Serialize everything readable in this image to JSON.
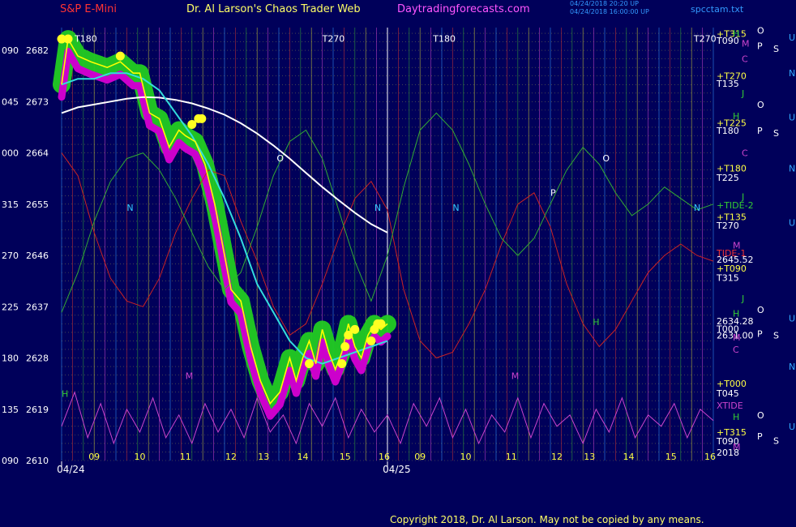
{
  "header": {
    "left": "S&P E-Mini",
    "center": "Dr. Al Larson's Chaos Trader Web",
    "site": "Daytradingforecasts.com",
    "right": "spcctam.txt",
    "stamp1": "04/24/2018 20:20 UP",
    "stamp2": "04/24/2018 16:00:00 UP"
  },
  "colors": {
    "background": "#00005a",
    "price_line": "#ffff00",
    "price_glow": "#22cc22",
    "magenta_band": "#cc00cc",
    "cyan_avg": "#33dddd",
    "white_avg": "#ffffff",
    "tide1": "#cc2222",
    "tide2": "#33aa33",
    "xtide": "#cc44cc"
  },
  "chart_data": {
    "type": "line",
    "title": "S&P E-Mini",
    "ylim": [
      2610,
      2686
    ],
    "xlim": [
      0,
      2
    ],
    "y_ticks": [
      {
        "angle": "090",
        "price": 2682
      },
      {
        "angle": "045",
        "price": 2673
      },
      {
        "angle": "000",
        "price": 2664
      },
      {
        "angle": "315",
        "price": 2655
      },
      {
        "angle": "270",
        "price": 2646
      },
      {
        "angle": "225",
        "price": 2637
      },
      {
        "angle": "180",
        "price": 2628
      },
      {
        "angle": "135",
        "price": 2619
      },
      {
        "angle": "090",
        "price": 2610
      }
    ],
    "x_ticks": [
      {
        "label": "09",
        "x": 0.1
      },
      {
        "label": "10",
        "x": 0.24
      },
      {
        "label": "11",
        "x": 0.38
      },
      {
        "label": "12",
        "x": 0.52
      },
      {
        "label": "13",
        "x": 0.62
      },
      {
        "label": "14",
        "x": 0.74
      },
      {
        "label": "15",
        "x": 0.87
      },
      {
        "label": "16",
        "x": 0.99
      },
      {
        "label": "09",
        "x": 1.1
      },
      {
        "label": "10",
        "x": 1.24
      },
      {
        "label": "11",
        "x": 1.38
      },
      {
        "label": "12",
        "x": 1.52
      },
      {
        "label": "13",
        "x": 1.62
      },
      {
        "label": "14",
        "x": 1.74
      },
      {
        "label": "15",
        "x": 1.87
      },
      {
        "label": "16",
        "x": 1.99
      }
    ],
    "dates": [
      {
        "label": "04/24",
        "x": 0.05
      },
      {
        "label": "04/25",
        "x": 1.05
      }
    ],
    "price": {
      "x": [
        0.0,
        0.02,
        0.05,
        0.09,
        0.14,
        0.18,
        0.22,
        0.24,
        0.27,
        0.3,
        0.33,
        0.36,
        0.38,
        0.41,
        0.44,
        0.47,
        0.49,
        0.52,
        0.55,
        0.58,
        0.61,
        0.64,
        0.67,
        0.7,
        0.72,
        0.74,
        0.76,
        0.78,
        0.8,
        0.82,
        0.84,
        0.86,
        0.88,
        0.9,
        0.92,
        0.94,
        0.96,
        0.98,
        1.0
      ],
      "values": [
        2676,
        2684,
        2681,
        2680,
        2679,
        2680,
        2678,
        2678,
        2671,
        2670,
        2665,
        2668,
        2667,
        2666,
        2662,
        2655,
        2649,
        2640,
        2638,
        2630,
        2624,
        2620,
        2622,
        2628,
        2624,
        2628,
        2631,
        2627,
        2633,
        2629,
        2626,
        2629,
        2634,
        2630,
        2628,
        2632,
        2634,
        2633,
        2634
      ]
    },
    "cyan_avg": {
      "x": [
        0.0,
        0.05,
        0.1,
        0.15,
        0.2,
        0.25,
        0.3,
        0.35,
        0.4,
        0.45,
        0.5,
        0.55,
        0.6,
        0.65,
        0.7,
        0.75,
        0.8,
        0.85,
        0.9,
        0.95,
        1.0
      ],
      "values": [
        2676,
        2677,
        2677,
        2678,
        2678,
        2677,
        2675,
        2671,
        2667,
        2662,
        2656,
        2649,
        2641,
        2636,
        2631,
        2628,
        2627,
        2628,
        2629,
        2630,
        2631
      ]
    },
    "white_avg": {
      "x": [
        0.0,
        0.05,
        0.1,
        0.15,
        0.2,
        0.25,
        0.3,
        0.35,
        0.4,
        0.45,
        0.5,
        0.55,
        0.6,
        0.65,
        0.7,
        0.75,
        0.8,
        0.85,
        0.9,
        0.95,
        1.0
      ],
      "values": [
        2671,
        2672,
        2672.5,
        2673,
        2673.5,
        2673.8,
        2673.7,
        2673.3,
        2672.7,
        2671.8,
        2670.7,
        2669.2,
        2667.4,
        2665.3,
        2663,
        2660.5,
        2658,
        2655.7,
        2653.5,
        2651.5,
        2650
      ]
    },
    "tide1": {
      "x": [
        0.0,
        0.05,
        0.1,
        0.15,
        0.2,
        0.25,
        0.3,
        0.35,
        0.4,
        0.45,
        0.5,
        0.55,
        0.6,
        0.65,
        0.7,
        0.75,
        0.8,
        0.85,
        0.9,
        0.95,
        1.0,
        1.05,
        1.1,
        1.15,
        1.2,
        1.25,
        1.3,
        1.35,
        1.4,
        1.45,
        1.5,
        1.55,
        1.6,
        1.65,
        1.7,
        1.75,
        1.8,
        1.85,
        1.9,
        1.95,
        2.0
      ],
      "values": [
        2664,
        2660,
        2650,
        2642,
        2638,
        2637,
        2642,
        2650,
        2656,
        2661,
        2660,
        2652,
        2645,
        2637,
        2632,
        2634,
        2641,
        2649,
        2656,
        2659,
        2654,
        2640,
        2631,
        2628,
        2629,
        2634,
        2640,
        2648,
        2655,
        2657,
        2651,
        2641,
        2634,
        2630,
        2633,
        2638,
        2643,
        2646,
        2648,
        2646,
        2645
      ]
    },
    "tide2": {
      "x": [
        0.0,
        0.05,
        0.1,
        0.15,
        0.2,
        0.25,
        0.3,
        0.35,
        0.4,
        0.45,
        0.5,
        0.55,
        0.6,
        0.65,
        0.7,
        0.75,
        0.8,
        0.85,
        0.9,
        0.95,
        1.0,
        1.05,
        1.1,
        1.15,
        1.2,
        1.25,
        1.3,
        1.35,
        1.4,
        1.45,
        1.5,
        1.55,
        1.6,
        1.65,
        1.7,
        1.75,
        1.8,
        1.85,
        1.9,
        1.95,
        2.0
      ],
      "values": [
        2636,
        2643,
        2652,
        2659,
        2663,
        2664,
        2661,
        2656,
        2650,
        2644,
        2640,
        2643,
        2651,
        2660,
        2666,
        2668,
        2663,
        2654,
        2645,
        2638,
        2646,
        2658,
        2668,
        2671,
        2668,
        2662,
        2655,
        2649,
        2646,
        2649,
        2655,
        2661,
        2665,
        2662,
        2657,
        2653,
        2655,
        2658,
        2656,
        2654,
        2655
      ]
    },
    "xtide": {
      "x": [
        0.0,
        0.04,
        0.08,
        0.12,
        0.16,
        0.2,
        0.24,
        0.28,
        0.32,
        0.36,
        0.4,
        0.44,
        0.48,
        0.52,
        0.56,
        0.6,
        0.64,
        0.68,
        0.72,
        0.76,
        0.8,
        0.84,
        0.88,
        0.92,
        0.96,
        1.0,
        1.04,
        1.08,
        1.12,
        1.16,
        1.2,
        1.24,
        1.28,
        1.32,
        1.36,
        1.4,
        1.44,
        1.48,
        1.52,
        1.56,
        1.6,
        1.64,
        1.68,
        1.72,
        1.76,
        1.8,
        1.84,
        1.88,
        1.92,
        1.96,
        2.0
      ],
      "values": [
        2616,
        2622,
        2614,
        2620,
        2613,
        2619,
        2615,
        2621,
        2614,
        2618,
        2613,
        2620,
        2615,
        2619,
        2614,
        2621,
        2615,
        2618,
        2613,
        2620,
        2616,
        2621,
        2614,
        2619,
        2615,
        2618,
        2613,
        2620,
        2616,
        2621,
        2614,
        2619,
        2613,
        2618,
        2615,
        2621,
        2614,
        2620,
        2616,
        2618,
        2613,
        2619,
        2615,
        2621,
        2614,
        2618,
        2616,
        2620,
        2614,
        2619,
        2617
      ]
    },
    "yellow_dots": [
      {
        "x": 0.0,
        "y": 2684
      },
      {
        "x": 0.02,
        "y": 2684
      },
      {
        "x": 0.18,
        "y": 2681
      },
      {
        "x": 0.4,
        "y": 2669
      },
      {
        "x": 0.42,
        "y": 2670
      },
      {
        "x": 0.43,
        "y": 2670
      },
      {
        "x": 0.76,
        "y": 2627
      },
      {
        "x": 0.86,
        "y": 2627
      },
      {
        "x": 0.87,
        "y": 2630
      },
      {
        "x": 0.88,
        "y": 2632
      },
      {
        "x": 0.9,
        "y": 2633
      },
      {
        "x": 0.95,
        "y": 2631
      },
      {
        "x": 0.96,
        "y": 2633
      },
      {
        "x": 0.97,
        "y": 2634
      },
      {
        "x": 0.98,
        "y": 2634
      }
    ],
    "annotations": [
      {
        "text": "T180",
        "x": 0.04,
        "y": 2683.5,
        "color": "#ffffff"
      },
      {
        "text": "T270",
        "x": 0.8,
        "y": 2683.5,
        "color": "#ffffff"
      },
      {
        "text": "T180",
        "x": 1.14,
        "y": 2683.5,
        "color": "#ffffff"
      },
      {
        "text": "T270",
        "x": 1.94,
        "y": 2683.5,
        "color": "#ffffff"
      },
      {
        "text": "O",
        "x": 0.66,
        "y": 2662.5,
        "color": "#ffffff"
      },
      {
        "text": "O",
        "x": 1.66,
        "y": 2662.5,
        "color": "#ffffff"
      },
      {
        "text": "P",
        "x": 1.5,
        "y": 2656.5,
        "color": "#ffffff"
      },
      {
        "text": "N",
        "x": 0.2,
        "y": 2653.8,
        "color": "#33ccff"
      },
      {
        "text": "N",
        "x": 0.96,
        "y": 2653.8,
        "color": "#33ccff"
      },
      {
        "text": "N",
        "x": 1.2,
        "y": 2653.8,
        "color": "#33ccff"
      },
      {
        "text": "N",
        "x": 1.94,
        "y": 2653.8,
        "color": "#33ccff"
      },
      {
        "text": "M",
        "x": 0.38,
        "y": 2624.3,
        "color": "#cc44cc"
      },
      {
        "text": "M",
        "x": 1.38,
        "y": 2624.3,
        "color": "#cc44cc"
      },
      {
        "text": "H",
        "x": 0.0,
        "y": 2621.2,
        "color": "#33cc33"
      },
      {
        "text": "H",
        "x": 1.63,
        "y": 2633.8,
        "color": "#33cc33"
      }
    ],
    "right_labels": [
      {
        "text": "+T315",
        "price": 2684.9,
        "color": "#ffff44"
      },
      {
        "text": "T090",
        "price": 2683.7,
        "color": "#ffffff"
      },
      {
        "text": "+T270",
        "price": 2677.5,
        "color": "#ffff44"
      },
      {
        "text": "T135",
        "price": 2676.2,
        "color": "#ffffff"
      },
      {
        "text": "+T225",
        "price": 2669.3,
        "color": "#ffff44"
      },
      {
        "text": "T180",
        "price": 2667.9,
        "color": "#ffffff"
      },
      {
        "text": "+T180",
        "price": 2661.3,
        "color": "#ffff44"
      },
      {
        "text": "T225",
        "price": 2659.7,
        "color": "#ffffff"
      },
      {
        "text": "+TIDE-2",
        "price": 2654.8,
        "color": "#33cc33"
      },
      {
        "text": "+T135",
        "price": 2652.8,
        "color": "#ffff44"
      },
      {
        "text": "T270",
        "price": 2651.3,
        "color": "#ffffff"
      },
      {
        "text": "TIDE-1",
        "price": 2646.4,
        "color": "#ee3333"
      },
      {
        "text": "2645.52",
        "price": 2645.3,
        "color": "#ffffff"
      },
      {
        "text": "+T090",
        "price": 2643.7,
        "color": "#ffff44"
      },
      {
        "text": "T315",
        "price": 2642.1,
        "color": "#ffffff"
      },
      {
        "text": "2634.28",
        "price": 2634.5,
        "color": "#ffffff"
      },
      {
        "text": "T000",
        "price": 2633.1,
        "color": "#ffffff"
      },
      {
        "text": "2631.00",
        "price": 2632.0,
        "color": "#ffffff"
      },
      {
        "text": "+T000",
        "price": 2623.5,
        "color": "#ffff44"
      },
      {
        "text": "T045",
        "price": 2621.8,
        "color": "#ffffff"
      },
      {
        "text": "XTIDE",
        "price": 2619.7,
        "color": "#cc44cc"
      },
      {
        "text": "+T315",
        "price": 2615.0,
        "color": "#ffff44"
      },
      {
        "text": "T090",
        "price": 2613.4,
        "color": "#ffffff"
      },
      {
        "text": "2018",
        "price": 2611.4,
        "color": "#ffffff"
      }
    ],
    "side_letters": [
      {
        "col": 0,
        "text": "H",
        "price": 2685.0,
        "color": "#33cc33"
      },
      {
        "col": 2,
        "text": "O",
        "price": 2685.5,
        "color": "#ffffff"
      },
      {
        "col": 4,
        "text": "U",
        "price": 2684.3,
        "color": "#33aaff"
      },
      {
        "col": 1,
        "text": "M",
        "price": 2683.2,
        "color": "#cc44cc"
      },
      {
        "col": 1,
        "text": "C",
        "price": 2680.5,
        "color": "#cc44cc"
      },
      {
        "col": 2,
        "text": "P",
        "price": 2682.8,
        "color": "#ffffff"
      },
      {
        "col": 3,
        "text": "S",
        "price": 2682.3,
        "color": "#ffffff"
      },
      {
        "col": 4,
        "text": "N",
        "price": 2678.0,
        "color": "#33aaff"
      },
      {
        "col": 1,
        "text": "J",
        "price": 2674.5,
        "color": "#33cc33"
      },
      {
        "col": 0,
        "text": "H",
        "price": 2670.5,
        "color": "#33cc33"
      },
      {
        "col": 2,
        "text": "O",
        "price": 2672.5,
        "color": "#ffffff"
      },
      {
        "col": 4,
        "text": "U",
        "price": 2670.3,
        "color": "#33aaff"
      },
      {
        "col": 2,
        "text": "P",
        "price": 2667.9,
        "color": "#ffffff"
      },
      {
        "col": 3,
        "text": "S",
        "price": 2667.5,
        "color": "#ffffff"
      },
      {
        "col": 1,
        "text": "C",
        "price": 2664.0,
        "color": "#cc44cc"
      },
      {
        "col": 4,
        "text": "N",
        "price": 2661.3,
        "color": "#33aaff"
      },
      {
        "col": 1,
        "text": "J",
        "price": 2656.3,
        "color": "#33cc33"
      },
      {
        "col": 4,
        "text": "U",
        "price": 2651.8,
        "color": "#33aaff"
      },
      {
        "col": 0,
        "text": "M",
        "price": 2647.8,
        "color": "#cc44cc"
      },
      {
        "col": 1,
        "text": "J",
        "price": 2638.5,
        "color": "#33cc33"
      },
      {
        "col": 0,
        "text": "H",
        "price": 2635.8,
        "color": "#33cc33"
      },
      {
        "col": 2,
        "text": "O",
        "price": 2636.5,
        "color": "#ffffff"
      },
      {
        "col": 2,
        "text": "P",
        "price": 2632.3,
        "color": "#ffffff"
      },
      {
        "col": 3,
        "text": "S",
        "price": 2632.0,
        "color": "#ffffff"
      },
      {
        "col": 4,
        "text": "U",
        "price": 2635.0,
        "color": "#33aaff"
      },
      {
        "col": 0,
        "text": "M",
        "price": 2631.6,
        "color": "#cc44cc"
      },
      {
        "col": 0,
        "text": "C",
        "price": 2629.5,
        "color": "#cc44cc"
      },
      {
        "col": 4,
        "text": "N",
        "price": 2626.5,
        "color": "#33aaff"
      },
      {
        "col": 0,
        "text": "H",
        "price": 2617.7,
        "color": "#33cc33"
      },
      {
        "col": 2,
        "text": "O",
        "price": 2618.0,
        "color": "#ffffff"
      },
      {
        "col": 4,
        "text": "U",
        "price": 2616.0,
        "color": "#33aaff"
      },
      {
        "col": 2,
        "text": "P",
        "price": 2614.3,
        "color": "#ffffff"
      },
      {
        "col": 3,
        "text": "S",
        "price": 2613.5,
        "color": "#ffffff"
      },
      {
        "col": 0,
        "text": "M",
        "price": 2612.4,
        "color": "#cc44cc"
      }
    ]
  },
  "footer": {
    "copyright": "Copyright 2018, Dr. Al Larson. May not be copied by any means."
  }
}
